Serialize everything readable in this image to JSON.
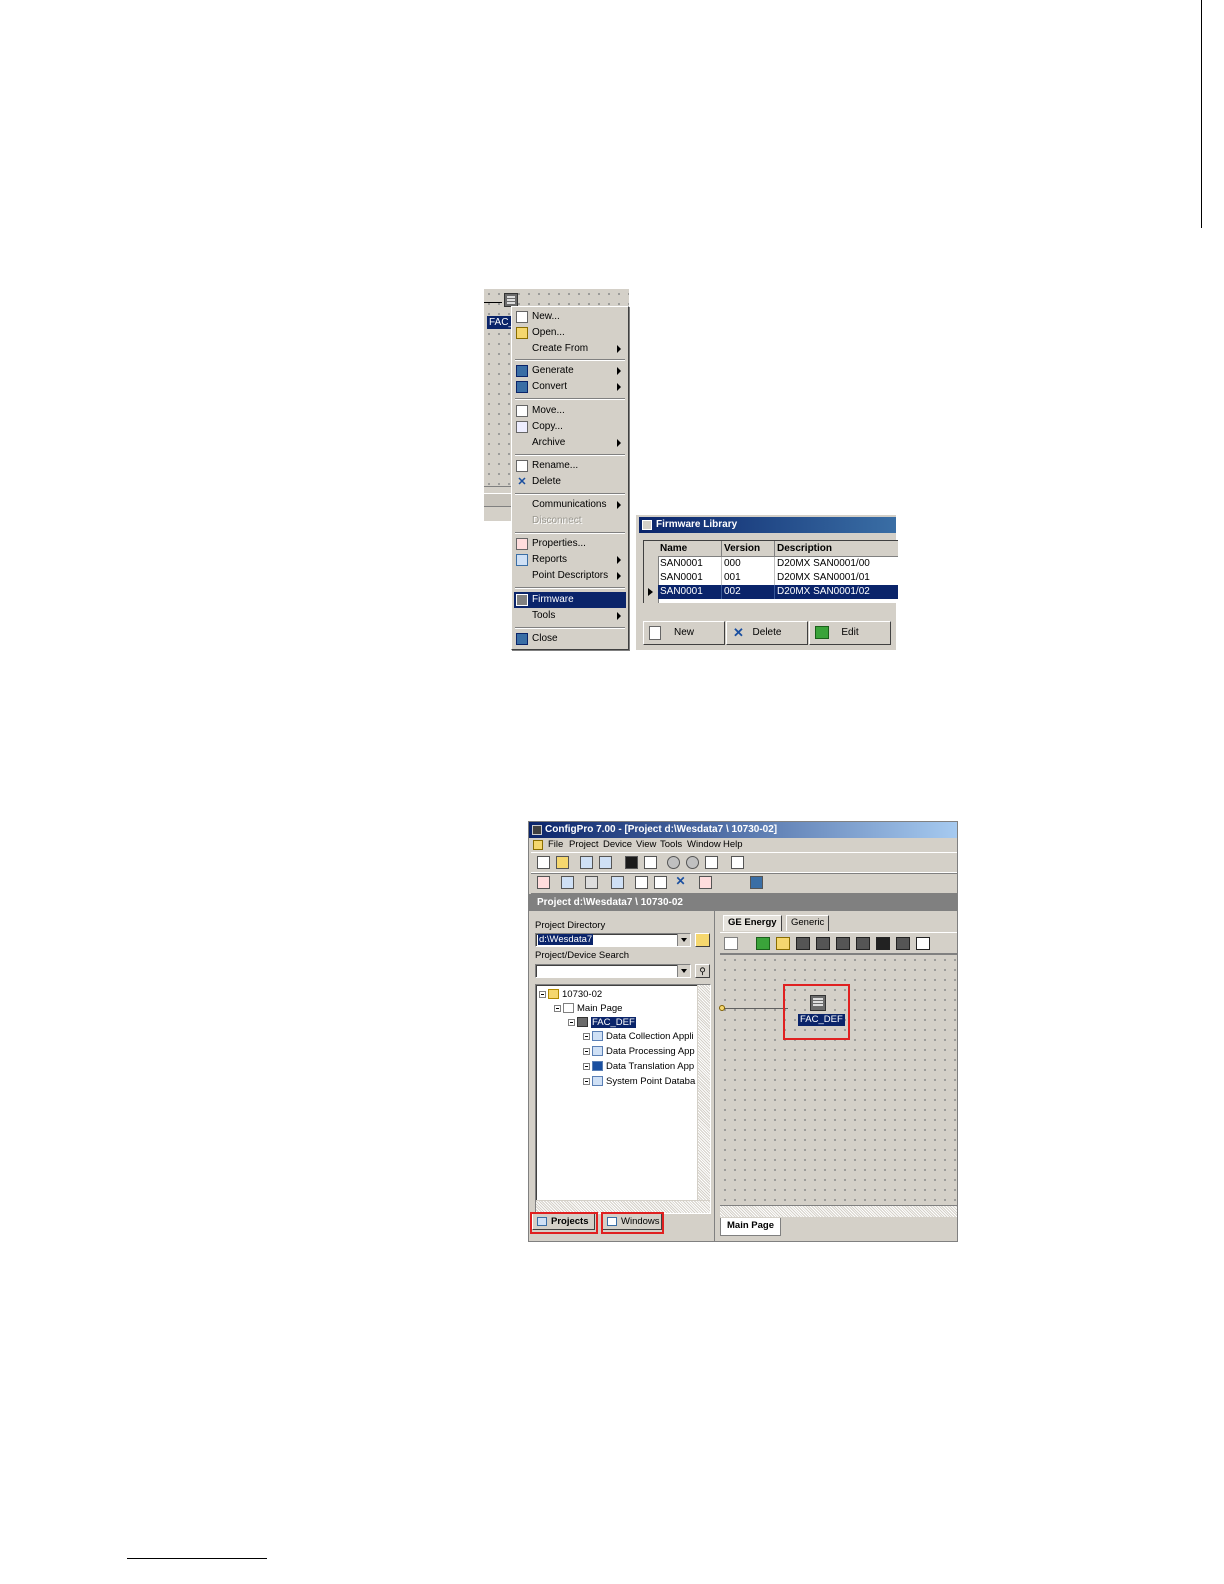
{
  "context_menu": {
    "device_label": "FAC_",
    "items": [
      {
        "label": "New...",
        "icon": "new-document-icon"
      },
      {
        "label": "Open...",
        "icon": "open-folder-icon"
      },
      {
        "label": "Create From",
        "submenu": true
      },
      {
        "label": "Generate",
        "icon": "generate-icon",
        "submenu": true
      },
      {
        "label": "Convert",
        "icon": "convert-icon",
        "submenu": true
      },
      {
        "label": "Move...",
        "icon": "move-icon"
      },
      {
        "label": "Copy...",
        "icon": "copy-icon"
      },
      {
        "label": "Archive",
        "submenu": true
      },
      {
        "label": "Rename...",
        "icon": "rename-icon"
      },
      {
        "label": "Delete",
        "icon": "delete-x-icon"
      },
      {
        "label": "Communications",
        "submenu": true
      },
      {
        "label": "Disconnect",
        "disabled": true
      },
      {
        "label": "Properties...",
        "icon": "properties-icon"
      },
      {
        "label": "Reports",
        "icon": "reports-icon",
        "submenu": true
      },
      {
        "label": "Point Descriptors",
        "submenu": true
      },
      {
        "label": "Firmware",
        "icon": "firmware-icon",
        "selected": true
      },
      {
        "label": "Tools",
        "submenu": true
      },
      {
        "label": "Close",
        "icon": "close-door-icon"
      }
    ]
  },
  "firmware_library": {
    "title": "Firmware Library",
    "columns": [
      "Name",
      "Version",
      "Description"
    ],
    "rows": [
      [
        "SAN0001",
        "000",
        "D20MX SAN0001/00"
      ],
      [
        "SAN0001",
        "001",
        "D20MX SAN0001/01"
      ],
      [
        "SAN0001",
        "002",
        "D20MX SAN0001/02"
      ]
    ],
    "selected_row": 2,
    "buttons": {
      "new": "New",
      "delete": "Delete",
      "edit": "Edit"
    }
  },
  "configpro": {
    "title": "ConfigPro 7.00 - [Project d:\\Wesdata7 \\ 10730-02]",
    "menu": [
      "File",
      "Project",
      "Device",
      "View",
      "Tools",
      "Window",
      "Help"
    ],
    "project_bar": "Project d:\\Wesdata7 \\ 10730-02",
    "project_directory_label": "Project Directory",
    "project_directory_value": "d:\\Wesdata7",
    "search_label": "Project/Device Search",
    "search_value": "",
    "tree": [
      {
        "label": "10730-02",
        "level": 0
      },
      {
        "label": "Main Page",
        "level": 1
      },
      {
        "label": "FAC_DEF",
        "level": 2,
        "selected": true
      },
      {
        "label": "Data Collection Appli",
        "level": 3
      },
      {
        "label": "Data Processing App",
        "level": 3
      },
      {
        "label": "Data Translation App",
        "level": 3
      },
      {
        "label": "System Point Databa",
        "level": 3
      }
    ],
    "left_tabs": {
      "projects": "Projects",
      "windows": "Windows"
    },
    "right_tabs": {
      "ge_energy": "GE Energy",
      "generic": "Generic"
    },
    "device_label": "FAC_DEF",
    "page_tab": "Main Page",
    "highlight_color": "#e02020",
    "selection_color": "#0a246a"
  }
}
